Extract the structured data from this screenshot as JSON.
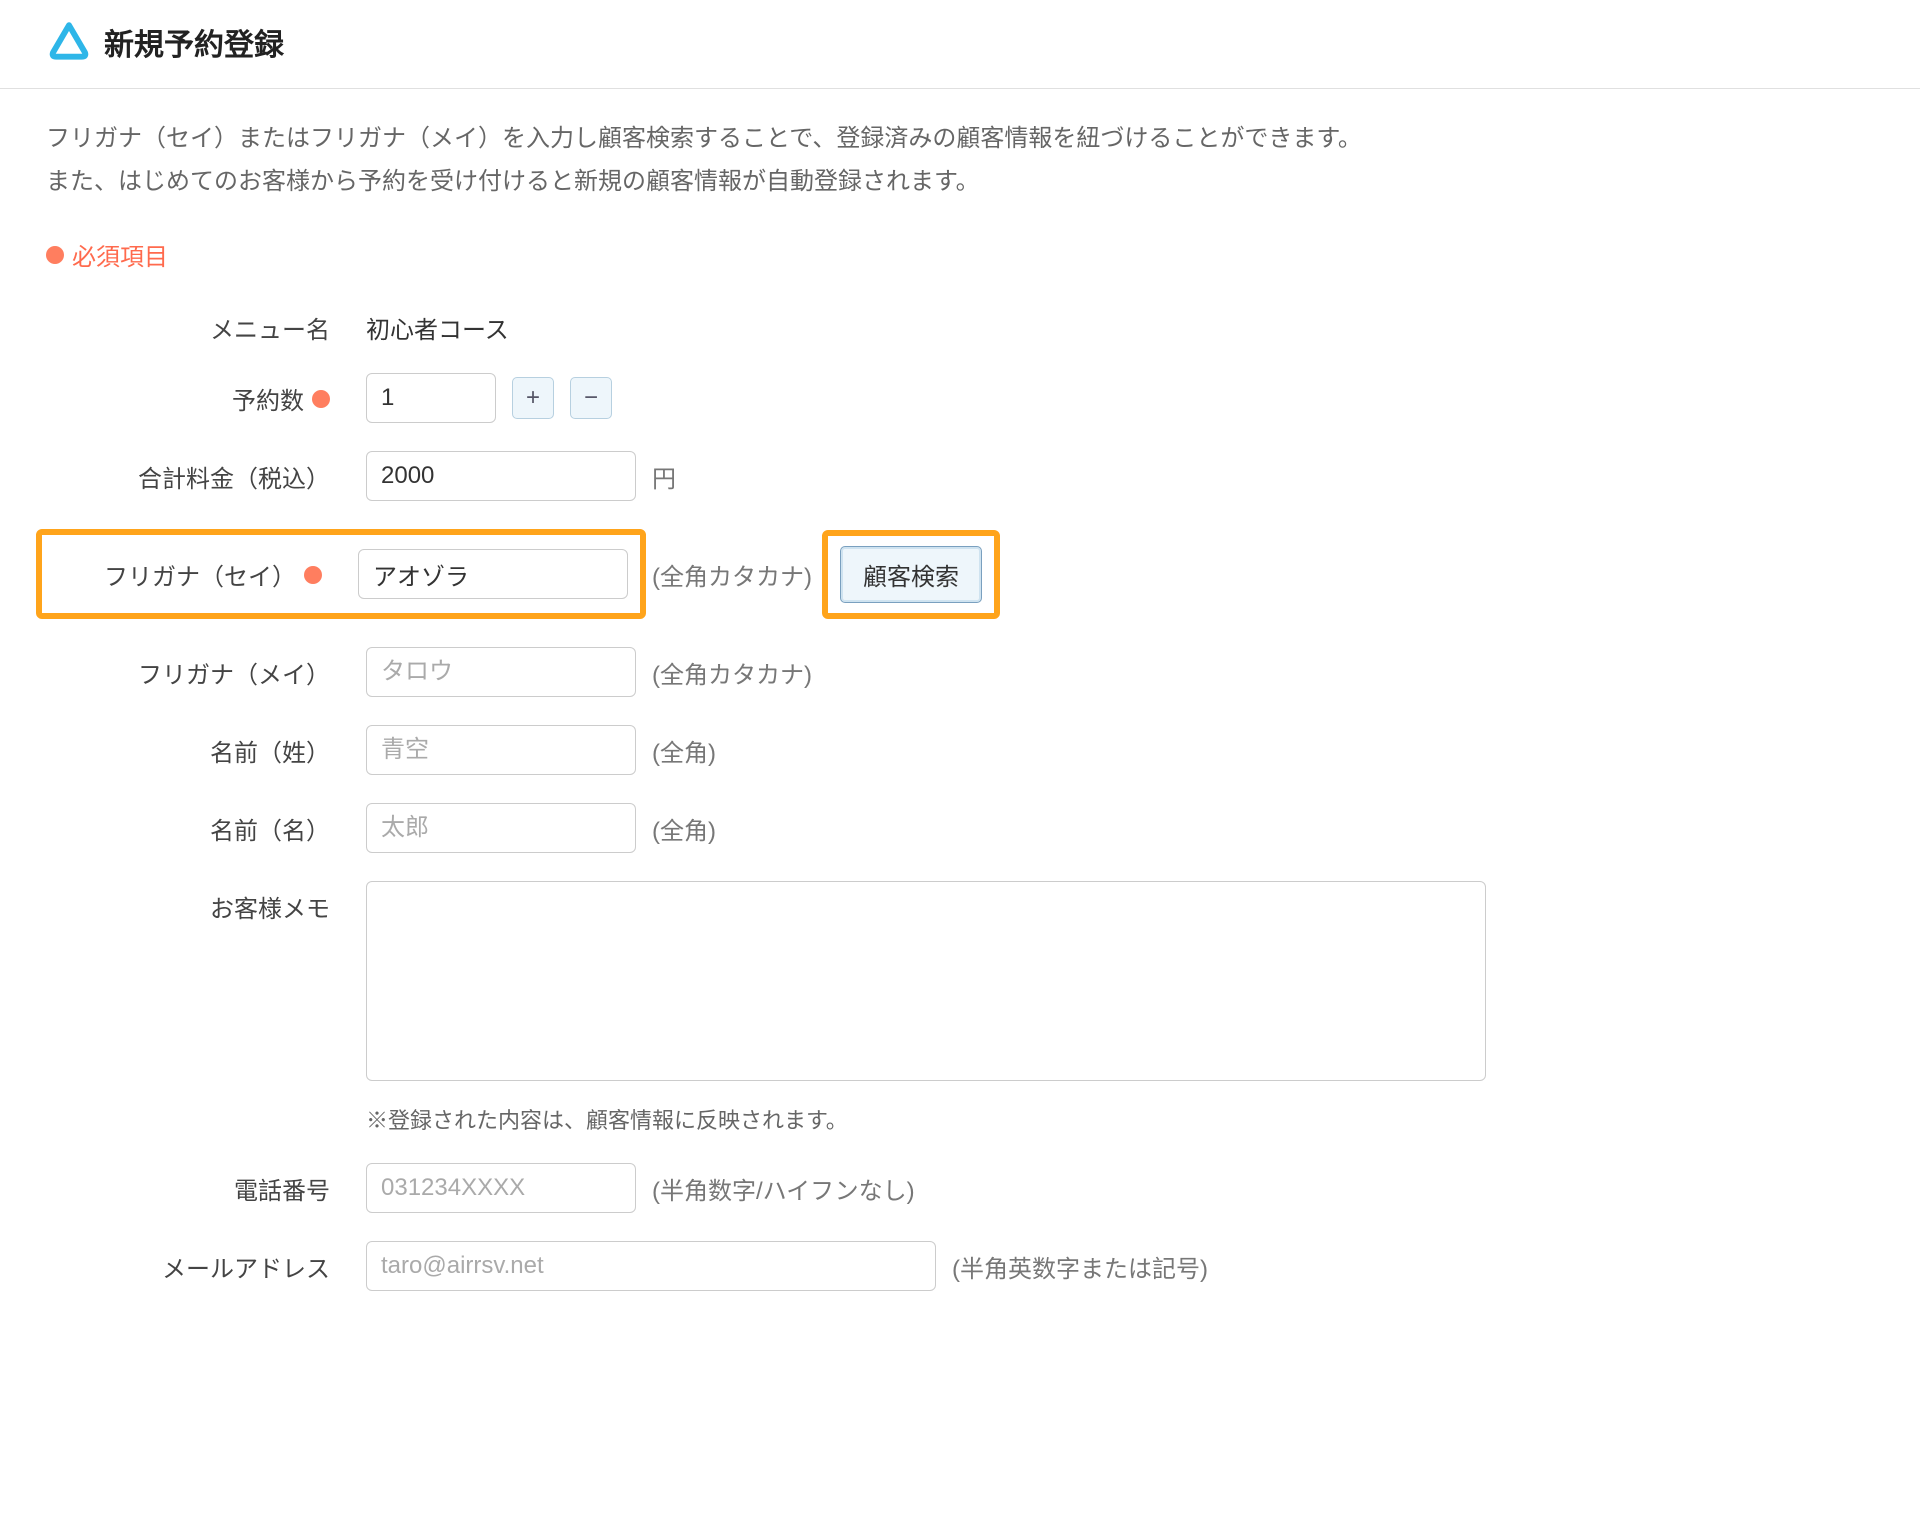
{
  "header": {
    "title": "新規予約登録"
  },
  "description": {
    "line1": "フリガナ（セイ）またはフリガナ（メイ）を入力し顧客検索することで、登録済みの顧客情報を紐づけることができます。",
    "line2": "また、はじめてのお客様から予約を受け付けると新規の顧客情報が自動登録されます。"
  },
  "required_legend": "必須項目",
  "form": {
    "menu": {
      "label": "メニュー名",
      "value": "初心者コース"
    },
    "quantity": {
      "label": "予約数",
      "value": "1",
      "plus": "+",
      "minus": "−"
    },
    "price": {
      "label": "合計料金（税込）",
      "value": "2000",
      "unit": "円"
    },
    "sei": {
      "label": "フリガナ（セイ）",
      "value": "アオゾラ",
      "hint": "(全角カタカナ)",
      "search": "顧客検索"
    },
    "mei": {
      "label": "フリガナ（メイ）",
      "placeholder": "タロウ",
      "hint": "(全角カタカナ)"
    },
    "lastname": {
      "label": "名前（姓）",
      "placeholder": "青空",
      "hint": "(全角)"
    },
    "firstname": {
      "label": "名前（名）",
      "placeholder": "太郎",
      "hint": "(全角)"
    },
    "memo": {
      "label": "お客様メモ",
      "note": "※登録された内容は、顧客情報に反映されます。"
    },
    "phone": {
      "label": "電話番号",
      "placeholder": "031234XXXX",
      "hint": "(半角数字/ハイフンなし)"
    },
    "email": {
      "label": "メールアドレス",
      "placeholder": "taro@airrsv.net",
      "hint": "(半角英数字または記号)"
    }
  }
}
